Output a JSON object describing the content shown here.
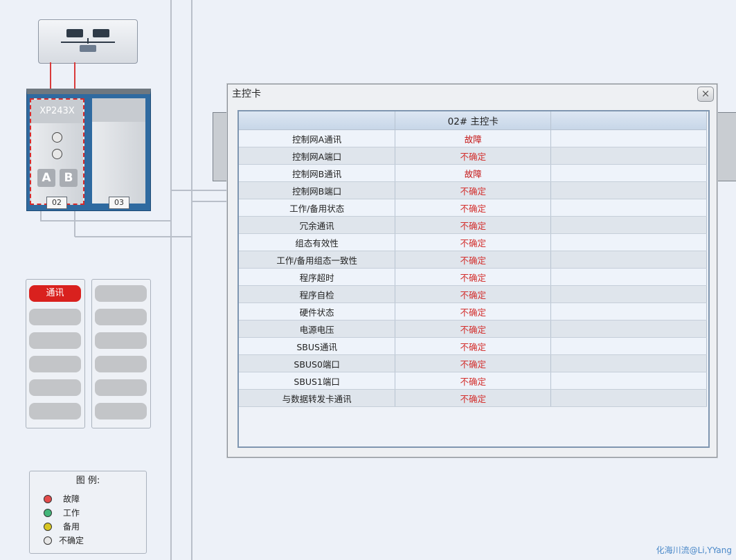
{
  "device": {
    "card_02_model": "XP243X",
    "card_02_btn_a": "A",
    "card_02_btn_b": "B",
    "slot_02": "02",
    "slot_03": "03"
  },
  "panels": {
    "left_active_label": "通讯"
  },
  "legend": {
    "title": "图 例:",
    "items": [
      {
        "label": "故障",
        "color": "#e34b4b"
      },
      {
        "label": "工作",
        "color": "#43b67a"
      },
      {
        "label": "备用",
        "color": "#d7c523"
      },
      {
        "label": "不确定",
        "color": "#e6e6e6"
      }
    ]
  },
  "dialog": {
    "title": "主控卡",
    "close_glyph": "×",
    "header": [
      "",
      "02# 主控卡",
      ""
    ],
    "rows": [
      {
        "name": "控制网A通讯",
        "value": "故障",
        "fault": true
      },
      {
        "name": "控制网A端口",
        "value": "不确定",
        "fault": false
      },
      {
        "name": "控制网B通讯",
        "value": "故障",
        "fault": true
      },
      {
        "name": "控制网B端口",
        "value": "不确定",
        "fault": false
      },
      {
        "name": "工作/备用状态",
        "value": "不确定",
        "fault": false
      },
      {
        "name": "冗余通讯",
        "value": "不确定",
        "fault": false
      },
      {
        "name": "组态有效性",
        "value": "不确定",
        "fault": false
      },
      {
        "name": "工作/备用组态一致性",
        "value": "不确定",
        "fault": false
      },
      {
        "name": "程序超时",
        "value": "不确定",
        "fault": false
      },
      {
        "name": "程序自检",
        "value": "不确定",
        "fault": false
      },
      {
        "name": "硬件状态",
        "value": "不确定",
        "fault": false
      },
      {
        "name": "电源电压",
        "value": "不确定",
        "fault": false
      },
      {
        "name": "SBUS通讯",
        "value": "不确定",
        "fault": false
      },
      {
        "name": "SBUS0端口",
        "value": "不确定",
        "fault": false
      },
      {
        "name": "SBUS1端口",
        "value": "不确定",
        "fault": false
      },
      {
        "name": "与数据转发卡通讯",
        "value": "不确定",
        "fault": false
      }
    ]
  },
  "watermark": "化海川流@Li,YYang"
}
